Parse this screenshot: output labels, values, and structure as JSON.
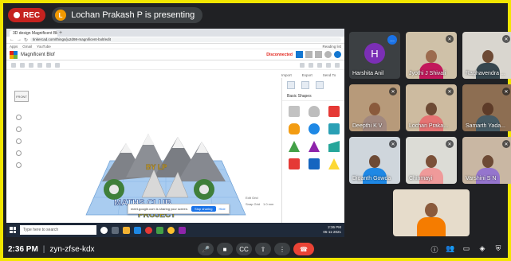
{
  "meet": {
    "rec_label": "REC",
    "presenter_initial": "L",
    "presenting_text": "Lochan Prakash P is presenting",
    "clock": "2:36 PM",
    "separator": "|",
    "meeting_code": "zyn-zfse-kdx"
  },
  "browser": {
    "tab_title": "3D design Magnificent Blof | Tin",
    "new_tab": "+",
    "url": "tinkercad.com/things/ju2d98-magnificent-bolt/edit",
    "bookmarks": [
      "Apps",
      "Gmail",
      "YouTube"
    ],
    "reading_list": "Reading list"
  },
  "tinkercad": {
    "design_title": "Magnificent Blof",
    "save_status": "Disconnected",
    "panel_labels": [
      "Import",
      "Export",
      "Send To"
    ],
    "panel_category": "Basic Shapes",
    "viewcube_label": "FRONT",
    "scene_text_1": "BY LP",
    "scene_text_2": "MATHS CLUB",
    "scene_text_3": "PROJECT",
    "edit_grid": "Edit Grid",
    "snap_grid": "Snap Grid",
    "snap_value": "1.0 mm"
  },
  "notification": {
    "text": "meet.google.com is sharing your screen.",
    "stop_label": "Stop sharing",
    "hide_label": "Hide"
  },
  "taskbar": {
    "search_placeholder": "Type here to search",
    "time": "2:36 PM",
    "date": "05-11-2021"
  },
  "participants": [
    {
      "name": "Harshita Anil",
      "initial": "H"
    },
    {
      "name": "Jyothi J Shivali"
    },
    {
      "name": "Raghavendra ..."
    },
    {
      "name": "Deepthi K V"
    },
    {
      "name": "Lochan Praka..."
    },
    {
      "name": "Samarth Yada..."
    },
    {
      "name": "Diganth Gowda"
    },
    {
      "name": "Chinmayi"
    },
    {
      "name": "Varshini S N"
    },
    {
      "name": ""
    }
  ],
  "more_label": "...",
  "controls": {
    "mic": "🎤",
    "cam": "■",
    "cc": "CC",
    "present": "⇧",
    "more": "⋮",
    "end": "☎"
  },
  "colors": {
    "frame": "#f2e600",
    "meet_bg": "#202124",
    "rec": "#c5221f",
    "end_call": "#ea4335",
    "accent": "#1a73e8"
  }
}
